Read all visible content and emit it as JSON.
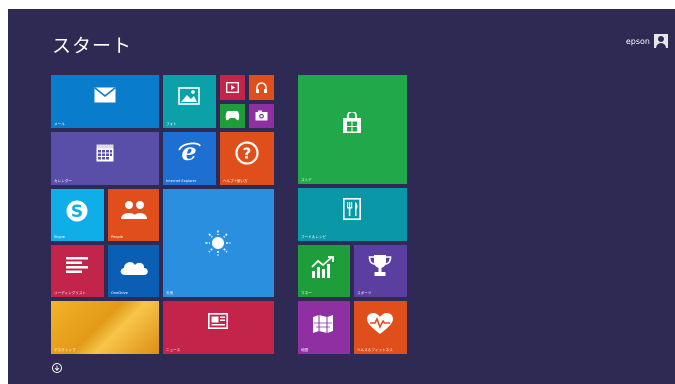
{
  "header": {
    "title": "スタート",
    "user_name": "epson"
  },
  "tiles": {
    "mail": {
      "label": "メール",
      "icon": "mail-icon",
      "color": "#0a7ccc"
    },
    "photos": {
      "label": "フォト",
      "icon": "photo-icon",
      "color": "#0aa2a8"
    },
    "video": {
      "label": "",
      "icon": "video-icon",
      "color": "#c2244a"
    },
    "music": {
      "label": "",
      "icon": "headphones-icon",
      "color": "#e04e1b"
    },
    "games": {
      "label": "",
      "icon": "gamepad-icon",
      "color": "#1e9e3a"
    },
    "camera": {
      "label": "",
      "icon": "camera-icon",
      "color": "#8e2fa2"
    },
    "calendar": {
      "label": "カレンダー",
      "icon": "calendar-icon",
      "color": "#5a4fa8"
    },
    "ie": {
      "label": "Internet Explorer",
      "icon": "internet-explorer-icon",
      "color": "#1d6fd1"
    },
    "help": {
      "label": "ヘルプ+使い方",
      "icon": "help-icon",
      "color": "#e04e1b"
    },
    "skype": {
      "label": "Skype",
      "icon": "skype-icon",
      "color": "#10aee8"
    },
    "people": {
      "label": "People",
      "icon": "people-icon",
      "color": "#e04e1b"
    },
    "weather": {
      "label": "天気",
      "icon": "sun-icon",
      "color": "#2b8fe0"
    },
    "reading": {
      "label": "リーディングリスト",
      "icon": "reading-list-icon",
      "color": "#c2244a"
    },
    "onedrive": {
      "label": "OneDrive",
      "icon": "cloud-icon",
      "color": "#0a5fb5"
    },
    "desktop": {
      "label": "デスクトップ",
      "icon": "",
      "color": "#e8a21a"
    },
    "news": {
      "label": "ニュース",
      "icon": "news-icon",
      "color": "#c2244a"
    },
    "store": {
      "label": "ストア",
      "icon": "store-icon",
      "color": "#20a84a"
    },
    "food": {
      "label": "フード＆レシピ",
      "icon": "food-icon",
      "color": "#0a97a8"
    },
    "finance": {
      "label": "マネー",
      "icon": "finance-icon",
      "color": "#1e9e3a"
    },
    "sports": {
      "label": "スポーツ",
      "icon": "trophy-icon",
      "color": "#5a3fa0"
    },
    "maps": {
      "label": "地図",
      "icon": "map-icon",
      "color": "#8e2fa2"
    },
    "health": {
      "label": "ヘルス＆フィットネス",
      "icon": "heart-icon",
      "color": "#e04e1b"
    }
  },
  "footer": {
    "apps_icon": "arrow-down-circle-icon"
  }
}
